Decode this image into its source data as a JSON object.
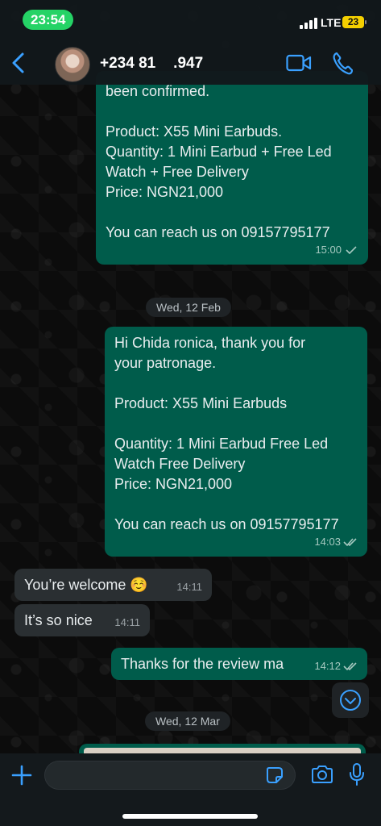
{
  "status_bar": {
    "time": "23:54",
    "network": "LTE",
    "battery": "23"
  },
  "header": {
    "contact_name": "+234 81       .947"
  },
  "messages": [
    {
      "direction": "out",
      "lines": [
        "been confirmed.",
        "",
        "Product: X55 Mini Earbuds.",
        "Quantity: 1 Mini Earbud + Free Led",
        "Watch + Free Delivery",
        "Price: NGN21,000",
        "",
        "You can reach us on 09157795177"
      ],
      "time": "15:00"
    },
    {
      "type": "date",
      "label": "Wed, 12 Feb"
    },
    {
      "direction": "out",
      "lines": [
        "Hi Chida        ronica, thank you for",
        "your patronage.",
        "",
        "Product: X55 Mini Earbuds",
        "",
        "Quantity: 1 Mini Earbud   Free Led",
        "Watch   Free Delivery",
        "Price: NGN21,000",
        "",
        "You can reach us on 09157795177"
      ],
      "time": "14:03"
    },
    {
      "direction": "in",
      "text": "You’re welcome ☺️",
      "time": "14:11"
    },
    {
      "direction": "in",
      "text": "It’s so nice",
      "time": "14:11"
    },
    {
      "direction": "out",
      "text": "Thanks for the review ma",
      "time": "14:12"
    },
    {
      "type": "date",
      "label": "Wed, 12 Mar"
    }
  ],
  "input": {
    "placeholder": "",
    "value": ""
  },
  "colors": {
    "outgoing_bubble": "#005c4b",
    "incoming_bubble": "#2a2f32",
    "accent": "#25d366",
    "icon_blue": "#3aa0ff"
  },
  "icons": [
    "back-icon",
    "video-call-icon",
    "phone-icon",
    "plus-icon",
    "sticker-icon",
    "camera-icon",
    "microphone-icon",
    "chevron-down-icon",
    "read-receipt-icon"
  ]
}
